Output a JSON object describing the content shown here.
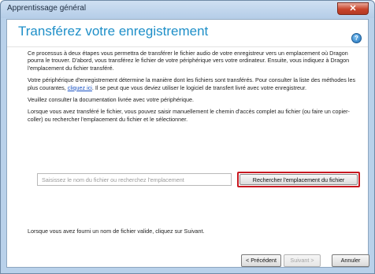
{
  "window": {
    "title": "Apprentissage général",
    "close_symbol": "✕"
  },
  "header": {
    "title": "Transférez votre enregistrement",
    "help_symbol": "?"
  },
  "body": {
    "para1": "Ce processus à deux étapes vous permettra de transférer le fichier audio de votre enregistreur vers un emplacement où Dragon pourra le trouver. D'abord, vous transférez le fichier de votre périphérique vers votre ordinateur. Ensuite, vous indiquez à Dragon l'emplacement du fichier transféré.",
    "para2_before": "Votre périphérique d'enregistrement détermine la manière dont les fichiers sont transférés. Pour consulter la liste des méthodes les plus courantes, ",
    "para2_link": "cliquez ici",
    "para2_after": ". Il se peut que vous deviez utiliser le logiciel de transfert livré avec votre enregistreur.",
    "para3": "Veuillez consulter la documentation livrée avec votre périphérique.",
    "para4": "Lorsque vous avez transféré le fichier, vous pouvez saisir manuellement le chemin d'accès complet au fichier (ou faire un copier-coller) ou rechercher l'emplacement du fichier et le sélectionner.",
    "path_placeholder": "Saisissez le nom du fichier ou recherchez l'emplacement",
    "browse_label": "Rechercher l'emplacement du fichier",
    "status": "Lorsque vous avez fourni un nom de fichier valide, cliquez sur Suivant."
  },
  "footer": {
    "prev_label": "< Précédent",
    "next_label": "Suivant >",
    "cancel_label": "Annuler"
  }
}
